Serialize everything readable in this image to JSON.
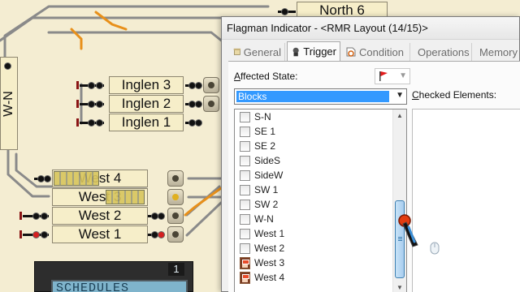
{
  "layout": {
    "blocks": {
      "north6": "North 6",
      "w_n": "W-N",
      "inglen3": "Inglen 3",
      "inglen2": "Inglen 2",
      "inglen1": "Inglen 1",
      "west4": "West 4",
      "west3": "West 3",
      "west2": "West 2",
      "west1": "West 1"
    },
    "scheduler_text": "SCHEDULES",
    "scheduler_number": "1",
    "colors": {
      "track": "#8a8a8a",
      "route_active": "#e8901a",
      "block_fill": "#f6eec9"
    }
  },
  "dialog": {
    "title": "Flagman Indicator - <RMR Layout (14/15)>",
    "tabs": [
      {
        "label": "General",
        "icon": "document-icon",
        "active": false
      },
      {
        "label": "Trigger",
        "icon": "trigger-icon",
        "active": true
      },
      {
        "label": "Condition",
        "icon": "condition-icon",
        "active": false
      },
      {
        "label": "Operations",
        "icon": "operations-icon",
        "active": false
      },
      {
        "label": "Memory",
        "icon": "memory-icon",
        "active": false
      }
    ],
    "affected_state_prefix": "A",
    "affected_state_rest": "ffected State:",
    "checked_prefix": "C",
    "checked_rest": "hecked Elements:",
    "selected_type": "Blocks",
    "items": [
      {
        "label": "S-N",
        "kind": "checkbox"
      },
      {
        "label": "SE 1",
        "kind": "checkbox"
      },
      {
        "label": "SE 2",
        "kind": "checkbox"
      },
      {
        "label": "SideS",
        "kind": "checkbox"
      },
      {
        "label": "SideW",
        "kind": "checkbox"
      },
      {
        "label": "SW 1",
        "kind": "checkbox"
      },
      {
        "label": "SW 2",
        "kind": "checkbox"
      },
      {
        "label": "W-N",
        "kind": "checkbox"
      },
      {
        "label": "West 1",
        "kind": "checkbox"
      },
      {
        "label": "West 2",
        "kind": "checkbox"
      },
      {
        "label": "West 3",
        "kind": "flagman"
      },
      {
        "label": "West 4",
        "kind": "flagman"
      }
    ]
  }
}
